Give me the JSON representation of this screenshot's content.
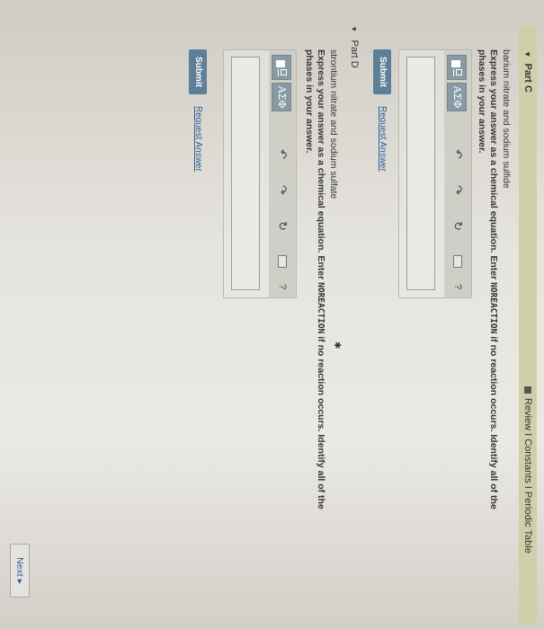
{
  "partC": {
    "header": "Part C",
    "links": "Review I Constants I Periodic Table",
    "reaction": "barium nitrate and sodium sulfide",
    "instruction1": "Express your answer as a chemical equation. Enter",
    "keyword": "NOREACTION",
    "instruction2": "if no reaction occurs. Identify all of the",
    "instruction3": "phases in your answer.",
    "toolbar": {
      "greek": "ΑΣΦ",
      "undo": "↶",
      "redo": "↷",
      "reset": "↻",
      "help": "?"
    },
    "answer_value": "",
    "submit": "Submit",
    "request": "Request Answer"
  },
  "partD": {
    "header": "Part D",
    "reaction": "strontium nitrate and sodium sulfate",
    "instruction1": "Express your answer as a chemical equation. Enter",
    "keyword": "NOREACTION",
    "instruction2": "if no reaction occurs. Identify all of the",
    "instruction3": "phases in your answer.",
    "toolbar": {
      "greek": "ΑΣΦ",
      "undo": "↶",
      "redo": "↷",
      "reset": "↻",
      "help": "?"
    },
    "answer_value": "",
    "submit": "Submit",
    "request": "Request Answer"
  },
  "next": "Next ▸",
  "tri": "▾",
  "star": "✱"
}
